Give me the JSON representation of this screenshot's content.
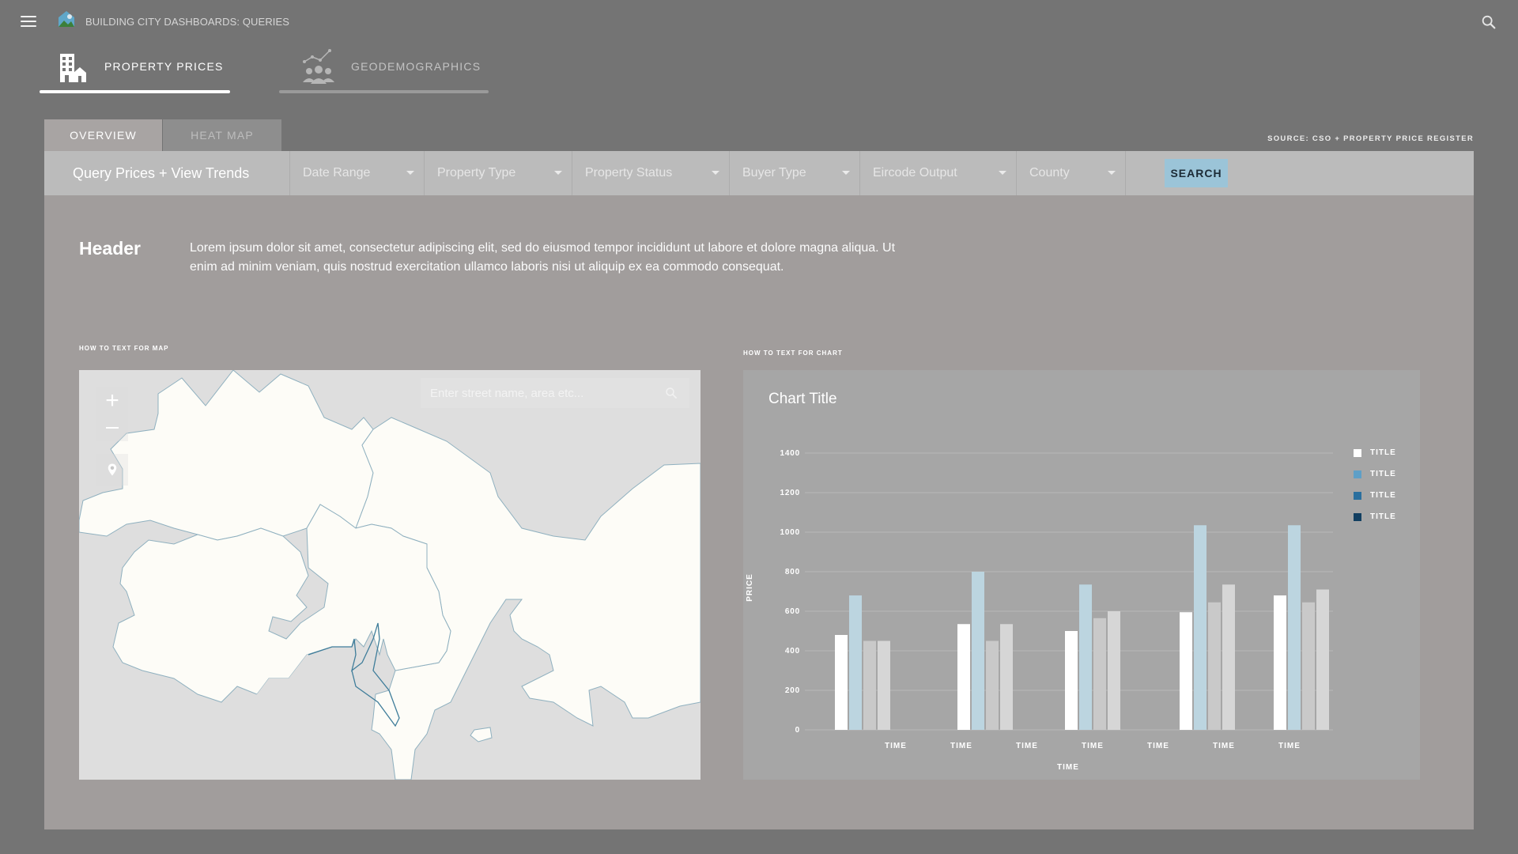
{
  "app": {
    "title": "BUILDING CITY DASHBOARDS: QUERIES",
    "icons": {
      "menu": "menu-icon",
      "logo": "logo-icon",
      "search": "search-icon"
    }
  },
  "main_tabs": [
    {
      "label": "PROPERTY PRICES",
      "icon": "building-icon",
      "active": true
    },
    {
      "label": "GEODEMOGRAPHICS",
      "icon": "people-trend-icon",
      "active": false
    }
  ],
  "sub_tabs": [
    {
      "label": "OVERVIEW",
      "active": true
    },
    {
      "label": "HEAT MAP",
      "active": false
    }
  ],
  "source_note": "SOURCE: CSO + PROPERTY PRICE REGISTER",
  "filter_bar": {
    "title": "Query Prices + View Trends",
    "dropdowns": [
      "Date Range",
      "Property Type",
      "Property Status",
      "Buyer Type",
      "Eircode Output",
      "County"
    ],
    "search_label": "SEARCH"
  },
  "intro": {
    "header": "Header",
    "body": "Lorem ipsum dolor sit amet, consectetur adipiscing elit, sed do eiusmod tempor incididunt ut labore et dolore magna aliqua. Ut enim ad minim veniam, quis nostrud exercitation ullamco laboris nisi ut aliquip ex ea commodo consequat."
  },
  "map": {
    "caption": "HOW TO TEXT FOR MAP",
    "search_placeholder": "Enter street name, area etc...",
    "controls": {
      "zoom_in": "+",
      "zoom_out": "zoom-out-icon",
      "locate": "location-pin-icon"
    }
  },
  "chart_caption": "HOW TO TEXT FOR CHART",
  "colors": {
    "series": [
      "#ffffff",
      "#bcd5e0",
      "#c9c9c9",
      "#d6d6d6"
    ],
    "legend": [
      "#ffffff",
      "#5e9fc7",
      "#2a6f9e",
      "#123f61"
    ],
    "search_button": "#9bc4d8"
  },
  "chart_data": {
    "type": "bar",
    "title": "Chart Title",
    "xlabel": "TIME",
    "ylabel": "PRICE",
    "ylim": [
      0,
      1400
    ],
    "yticks": [
      0,
      200,
      400,
      600,
      800,
      1000,
      1200,
      1400
    ],
    "grid": true,
    "legend_position": "top-right",
    "groups": [
      [
        480,
        680,
        450,
        450
      ],
      [
        535,
        800,
        450,
        535
      ],
      [
        500,
        735,
        565,
        600
      ],
      [
        595,
        1035,
        645,
        735
      ],
      [
        680,
        1035,
        645,
        710
      ]
    ],
    "x_tick_labels": [
      "TIME",
      "TIME",
      "TIME",
      "TIME",
      "TIME",
      "TIME",
      "TIME"
    ],
    "series": [
      {
        "name": "TITLE"
      },
      {
        "name": "TITLE"
      },
      {
        "name": "TITLE"
      },
      {
        "name": "TITLE"
      }
    ]
  }
}
